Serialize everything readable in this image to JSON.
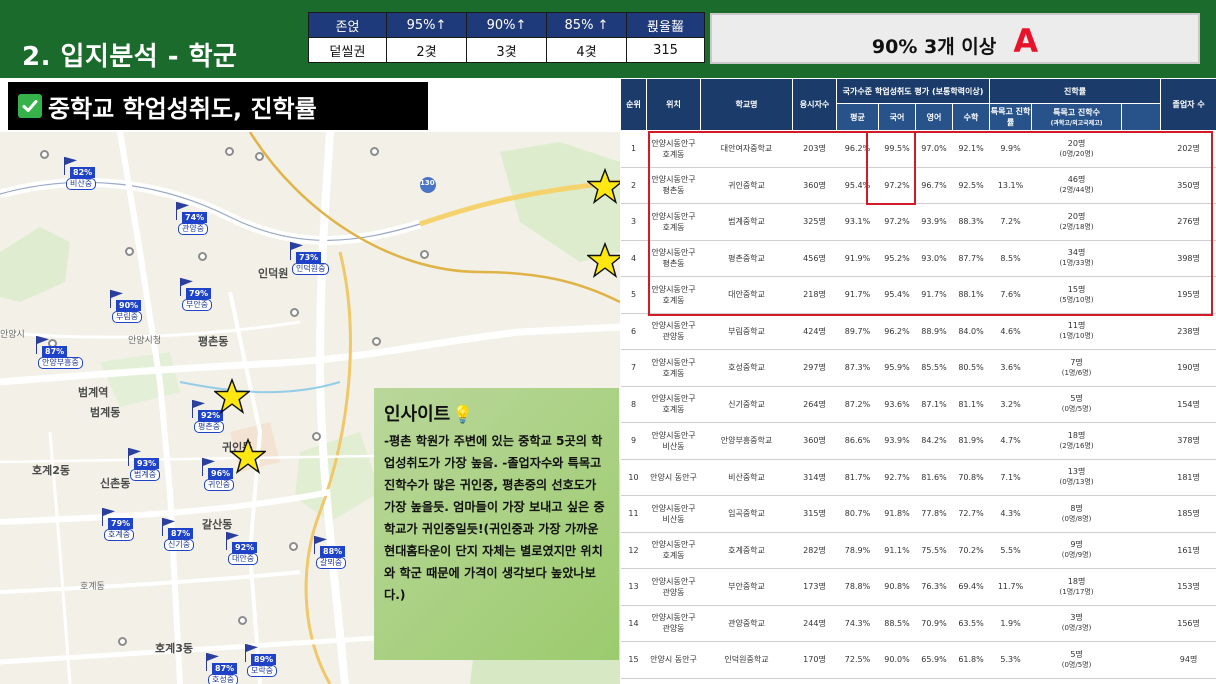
{
  "header": {
    "title": "2. 입지분석 - 학군",
    "summary_table": {
      "headers": [
        "존얹",
        "95%↑",
        "90%↑",
        "85% ↑",
        "퓑율齧"
      ],
      "values": [
        "덭씰권",
        "2겿",
        "3겿",
        "4겿",
        "315"
      ]
    },
    "verdict": {
      "text": "90% 3개 이상",
      "grade": "A"
    }
  },
  "section": {
    "title": "중학교 학업성취도, 진학률"
  },
  "colors": {
    "header_green": "#1b6b2c",
    "table_navy": "#1b3c6a",
    "highlight_red": "#d21b27",
    "pin_blue": "#1f43c8",
    "star_yellow": "#ffe812",
    "grade_red": "#e8132b"
  },
  "map": {
    "pins": [
      {
        "pct": "82%",
        "name": "비산중"
      },
      {
        "pct": "74%",
        "name": "관양중"
      },
      {
        "pct": "73%",
        "name": "인덕원중"
      },
      {
        "pct": "79%",
        "name": "부안중"
      },
      {
        "pct": "90%",
        "name": "부림중"
      },
      {
        "pct": "87%",
        "name": "안양부흥중"
      },
      {
        "pct": "92%",
        "name": "평촌중"
      },
      {
        "pct": "96%",
        "name": "귀인중"
      },
      {
        "pct": "93%",
        "name": "범계중"
      },
      {
        "pct": "79%",
        "name": "호계중"
      },
      {
        "pct": "87%",
        "name": "신기중"
      },
      {
        "pct": "92%",
        "name": "대안중"
      },
      {
        "pct": "88%",
        "name": "갈뫼중"
      },
      {
        "pct": "87%",
        "name": "호성중"
      },
      {
        "pct": "89%",
        "name": "모락중"
      }
    ],
    "labels": {
      "beomgye_station": "범계역",
      "beomgye_dong": "범계동",
      "pyeongchon_dong": "평촌동",
      "galsan_dong": "갈산동",
      "hogye3_dong": "호계3동",
      "hogye2_dong": "호계2동",
      "sinchon_dong": "신촌동",
      "gwiin_dong": "귀인동",
      "inducwon": "인덕원",
      "anyang_si": "안양시",
      "hogye_dong": "호계동",
      "anyang_city_hall": "안양시청",
      "highway_num": "130"
    }
  },
  "insight": {
    "title": "인사이트",
    "body": "-평촌 학원가 주변에 있는 중학교 5곳의 학업성취도가 가장 높음.\n-졸업자수와 특목고진학수가 많은 귀인중, 평촌중의 선호도가 가장 높을듯. 엄마들이 가장 보내고 싶은 중학교가 귀인중일듯!(귀인중과 가장 가까운 현대홈타운이 단지 자체는 별로였지만 위치와 학군 때문에 가격이 생각보다 높았나보다.)"
  },
  "school_table": {
    "headers": {
      "rank": "순위",
      "location": "위치",
      "school": "학교명",
      "applicants": "응시자수",
      "achievement_group": "국가수준 학업성취도 평가 (보통학력이상)",
      "avg": "평균",
      "korean": "국어",
      "english": "영어",
      "math": "수학",
      "advance_group": "진학률",
      "special_rate": "특목고 진학률",
      "special_count": "특목고 진학수",
      "special_count_sub": "(과학고/외고국제고)",
      "graduates": "졸업자 수"
    },
    "rows": [
      {
        "rank": "1",
        "loc": "안양시동안구 호계동",
        "school": "대안여자중학교",
        "applicants": "203명",
        "avg": "96.2%",
        "kor": "99.5%",
        "eng": "97.0%",
        "math": "92.1%",
        "sp_rate": "9.9%",
        "sp_cnt": "20명",
        "sp_sub": "(0명/20명)",
        "grad": "202명"
      },
      {
        "rank": "2",
        "loc": "안양시동안구 평촌동",
        "school": "귀인중학교",
        "applicants": "360명",
        "avg": "95.4%",
        "kor": "97.2%",
        "eng": "96.7%",
        "math": "92.5%",
        "sp_rate": "13.1%",
        "sp_cnt": "46명",
        "sp_sub": "(2명/44명)",
        "grad": "350명"
      },
      {
        "rank": "3",
        "loc": "안양시동안구 호계동",
        "school": "범계중학교",
        "applicants": "325명",
        "avg": "93.1%",
        "kor": "97.2%",
        "eng": "93.9%",
        "math": "88.3%",
        "sp_rate": "7.2%",
        "sp_cnt": "20명",
        "sp_sub": "(2명/18명)",
        "grad": "276명"
      },
      {
        "rank": "4",
        "loc": "안양시동안구 평촌동",
        "school": "평촌중학교",
        "applicants": "456명",
        "avg": "91.9%",
        "kor": "95.2%",
        "eng": "93.0%",
        "math": "87.7%",
        "sp_rate": "8.5%",
        "sp_cnt": "34명",
        "sp_sub": "(1명/33명)",
        "grad": "398명"
      },
      {
        "rank": "5",
        "loc": "안양시동안구 호계동",
        "school": "대안중학교",
        "applicants": "218명",
        "avg": "91.7%",
        "kor": "95.4%",
        "eng": "91.7%",
        "math": "88.1%",
        "sp_rate": "7.6%",
        "sp_cnt": "15명",
        "sp_sub": "(5명/10명)",
        "grad": "195명"
      },
      {
        "rank": "6",
        "loc": "안양시동안구 관양동",
        "school": "부림중학교",
        "applicants": "424명",
        "avg": "89.7%",
        "kor": "96.2%",
        "eng": "88.9%",
        "math": "84.0%",
        "sp_rate": "4.6%",
        "sp_cnt": "11명",
        "sp_sub": "(1명/10명)",
        "grad": "238명"
      },
      {
        "rank": "7",
        "loc": "안양시동안구 호계동",
        "school": "호성중학교",
        "applicants": "297명",
        "avg": "87.3%",
        "kor": "95.9%",
        "eng": "85.5%",
        "math": "80.5%",
        "sp_rate": "3.6%",
        "sp_cnt": "7명",
        "sp_sub": "(1명/6명)",
        "grad": "190명"
      },
      {
        "rank": "8",
        "loc": "안양시동안구 호계동",
        "school": "신기중학교",
        "applicants": "264명",
        "avg": "87.2%",
        "kor": "93.6%",
        "eng": "87.1%",
        "math": "81.1%",
        "sp_rate": "3.2%",
        "sp_cnt": "5명",
        "sp_sub": "(0명/5명)",
        "grad": "154명"
      },
      {
        "rank": "9",
        "loc": "안양시동안구 비산동",
        "school": "안양부흥중학교",
        "applicants": "360명",
        "avg": "86.6%",
        "kor": "93.9%",
        "eng": "84.2%",
        "math": "81.9%",
        "sp_rate": "4.7%",
        "sp_cnt": "18명",
        "sp_sub": "(2명/16명)",
        "grad": "378명"
      },
      {
        "rank": "10",
        "loc": "안양시 동안구",
        "school": "비산중학교",
        "applicants": "314명",
        "avg": "81.7%",
        "kor": "92.7%",
        "eng": "81.6%",
        "math": "70.8%",
        "sp_rate": "7.1%",
        "sp_cnt": "13명",
        "sp_sub": "(0명/13명)",
        "grad": "181명"
      },
      {
        "rank": "11",
        "loc": "안양시동안구 비산동",
        "school": "임곡중학교",
        "applicants": "315명",
        "avg": "80.7%",
        "kor": "91.8%",
        "eng": "77.8%",
        "math": "72.7%",
        "sp_rate": "4.3%",
        "sp_cnt": "8명",
        "sp_sub": "(0명/8명)",
        "grad": "185명"
      },
      {
        "rank": "12",
        "loc": "안양시동안구 호계동",
        "school": "호계중학교",
        "applicants": "282명",
        "avg": "78.9%",
        "kor": "91.1%",
        "eng": "75.5%",
        "math": "70.2%",
        "sp_rate": "5.5%",
        "sp_cnt": "9명",
        "sp_sub": "(0명/9명)",
        "grad": "161명"
      },
      {
        "rank": "13",
        "loc": "안양시동안구 관양동",
        "school": "부안중학교",
        "applicants": "173명",
        "avg": "78.8%",
        "kor": "90.8%",
        "eng": "76.3%",
        "math": "69.4%",
        "sp_rate": "11.7%",
        "sp_cnt": "18명",
        "sp_sub": "(1명/17명)",
        "grad": "153명"
      },
      {
        "rank": "14",
        "loc": "안양시동안구 관양동",
        "school": "관양중학교",
        "applicants": "244명",
        "avg": "74.3%",
        "kor": "88.5%",
        "eng": "70.9%",
        "math": "63.5%",
        "sp_rate": "1.9%",
        "sp_cnt": "3명",
        "sp_sub": "(0명/3명)",
        "grad": "156명"
      },
      {
        "rank": "15",
        "loc": "안양시 동안구",
        "school": "인덕원중학교",
        "applicants": "170명",
        "avg": "72.5%",
        "kor": "90.0%",
        "eng": "65.9%",
        "math": "61.8%",
        "sp_rate": "5.3%",
        "sp_cnt": "5명",
        "sp_sub": "(0명/5명)",
        "grad": "94명"
      }
    ]
  }
}
